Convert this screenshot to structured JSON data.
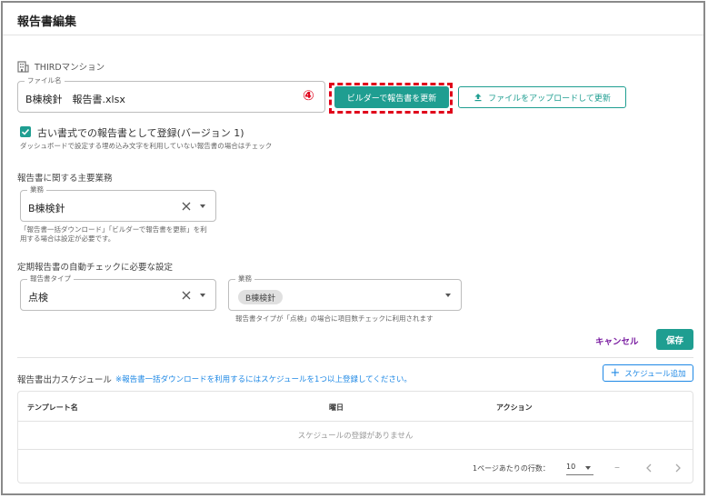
{
  "header": {
    "title": "報告書編集"
  },
  "property": {
    "icon": "building-icon",
    "name": "THIRDマンション"
  },
  "file": {
    "label": "ファイル名",
    "value": "B棟検針　報告書.xlsx",
    "marker": "④",
    "builder_button": "ビルダーで報告書を更新",
    "upload_button": "ファイルをアップロードして更新",
    "upload_icon": "upload-icon"
  },
  "legacy": {
    "checked": true,
    "label": "古い書式での報告書として登録(バージョン 1)",
    "helper": "ダッシュボードで設定する埋め込み文字を利用していない報告書の場合はチェック"
  },
  "business": {
    "section_title": "報告書に関する主要業務",
    "field_label": "業務",
    "value": "B棟検針",
    "helper_line1": "「報告書一括ダウンロード」「ビルダーで報告書を更新」を利",
    "helper_line2": "用する場合は設定が必要です。"
  },
  "auto_check": {
    "section_title": "定期報告書の自動チェックに必要な設定",
    "type_label": "報告書タイプ",
    "type_value": "点検",
    "work_label": "業務",
    "work_chip": "B棟検針",
    "helper": "報告書タイプが「点検」の場合に項目数チェックに利用されます"
  },
  "actions": {
    "cancel": "キャンセル",
    "save": "保存"
  },
  "schedule": {
    "title": "報告書出力スケジュール",
    "note": "※報告書一括ダウンロードを利用するにはスケジュールを1つ以上登録してください。",
    "add_button": "スケジュール追加",
    "columns": [
      "テンプレート名",
      "曜日",
      "アクション"
    ],
    "empty": "スケジュールの登録がありません",
    "rows_per_page_label": "1ページあたりの行数：",
    "rows_per_page": "10",
    "range": "–"
  },
  "colors": {
    "accent": "#1f9e91",
    "highlight": "#e0001a",
    "link_blue": "#1e88e5",
    "cancel": "#7b1fa2"
  }
}
